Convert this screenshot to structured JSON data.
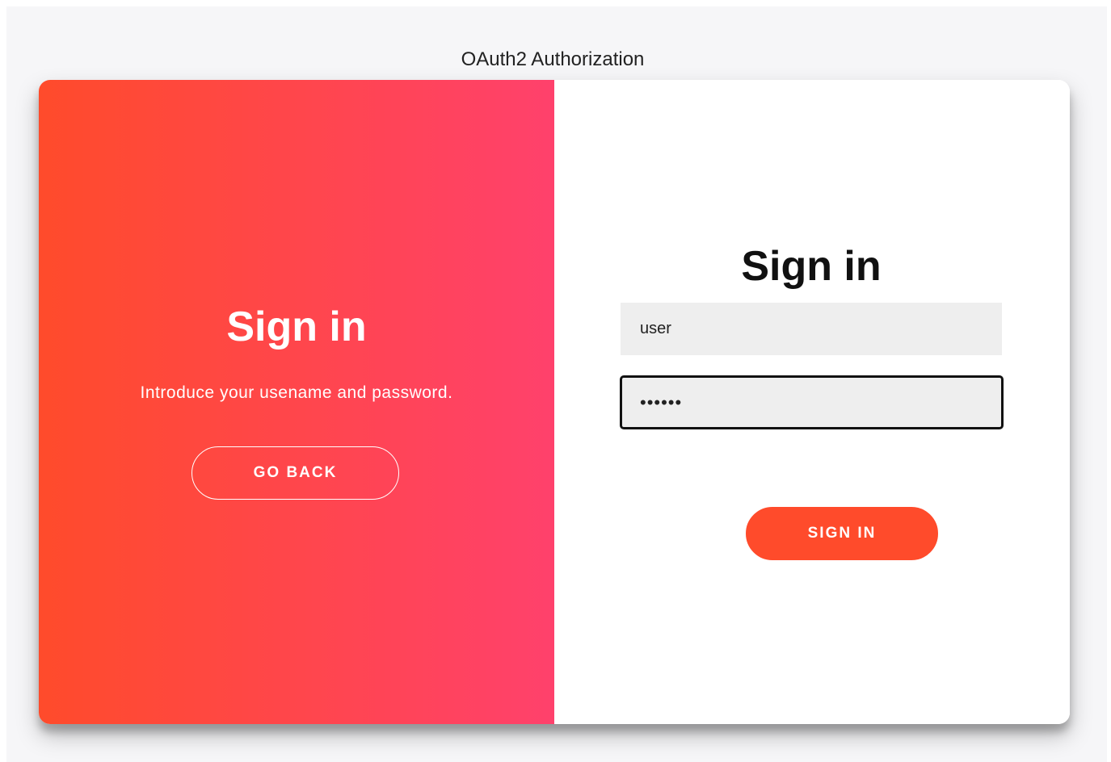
{
  "page": {
    "title": "OAuth2 Authorization"
  },
  "overlay": {
    "title": "Sign in",
    "text": "Introduce your usename and password.",
    "go_back_label": "GO BACK"
  },
  "form": {
    "title": "Sign in",
    "username_value": "user",
    "password_value": "••••••",
    "submit_label": "SIGN IN"
  },
  "colors": {
    "gradient_start": "#ff4b2b",
    "gradient_end": "#ff416c",
    "button_primary": "#ff4b2b",
    "input_background": "#eeeeee"
  }
}
